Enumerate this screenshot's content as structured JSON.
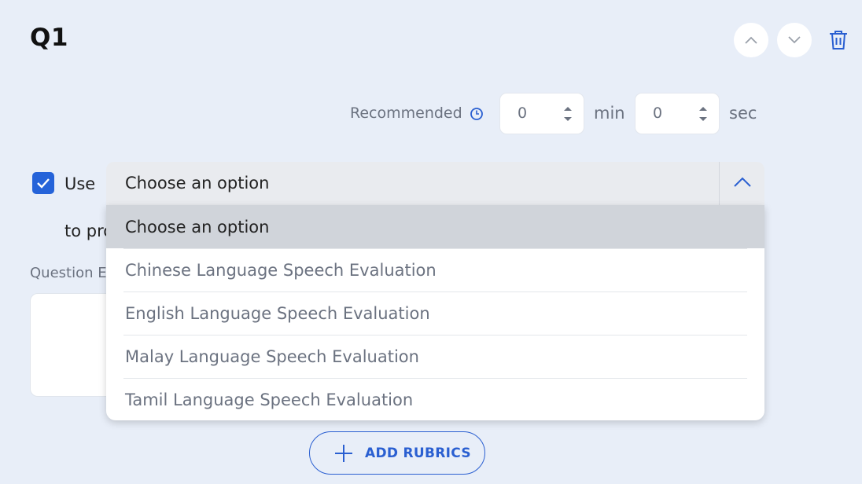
{
  "question": {
    "title": "Q1"
  },
  "header_actions": {
    "move_up_icon": "chevron-up-icon",
    "move_down_icon": "chevron-down-icon",
    "delete_icon": "trash-icon"
  },
  "recommended_time": {
    "label": "Recommended",
    "icon": "clock-icon",
    "minutes_value": "0",
    "minutes_unit": "min",
    "seconds_value": "0",
    "seconds_unit": "sec"
  },
  "use_tool": {
    "checked": true,
    "use_label": "Use",
    "to_label_visible": "to pro"
  },
  "evaluation_select": {
    "selected": "Choose an option",
    "expanded": true,
    "options": [
      "Choose an option",
      "Chinese Language Speech Evaluation",
      "English Language Speech Evaluation",
      "Malay Language Speech Evaluation",
      "Tamil Language Speech Evaluation"
    ]
  },
  "question_explanation": {
    "label_visible": "Question E"
  },
  "add_rubrics": {
    "label": "ADD RUBRICS",
    "icon": "plus-icon"
  },
  "colors": {
    "background": "#e8eef8",
    "accent": "#2563d9",
    "muted_text": "#6b7280",
    "selected_option_bg": "#d0d4da"
  }
}
